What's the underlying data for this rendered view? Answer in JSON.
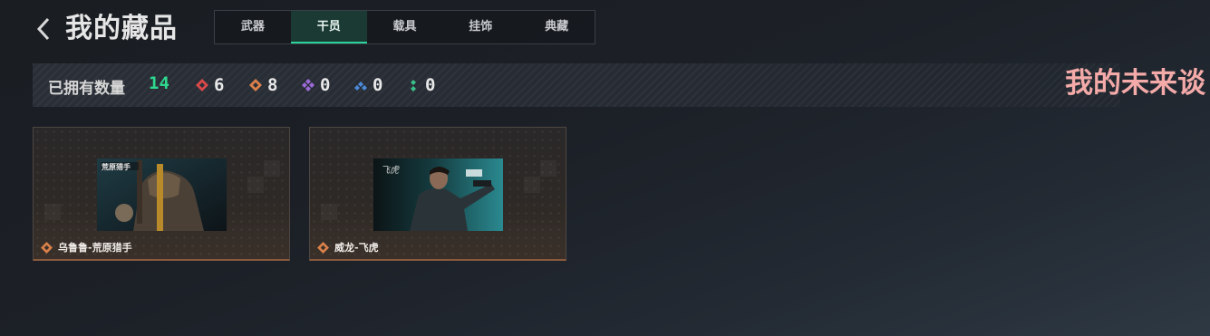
{
  "header": {
    "title": "我的藏品"
  },
  "tabs": [
    {
      "label": "武器",
      "active": false
    },
    {
      "label": "干员",
      "active": true
    },
    {
      "label": "载具",
      "active": false
    },
    {
      "label": "挂饰",
      "active": false
    },
    {
      "label": "典藏",
      "active": false
    }
  ],
  "stats": {
    "owned_label": "已拥有数量",
    "owned_count": "14",
    "rarities": [
      {
        "icon": "red-diamond-icon",
        "color": "#d9484a",
        "count": "6"
      },
      {
        "icon": "orange-diamond-icon",
        "color": "#d9804a",
        "count": "8"
      },
      {
        "icon": "purple-diamond-icon",
        "color": "#9a6ad8",
        "count": "0"
      },
      {
        "icon": "blue-diamond-icon",
        "color": "#4a8ad8",
        "count": "0"
      },
      {
        "icon": "green-diamond-icon",
        "color": "#3ac08a",
        "count": "0"
      }
    ]
  },
  "marquee": {
    "text": "我的未来谈"
  },
  "cards": [
    {
      "name": "乌鲁鲁-荒原猎手",
      "rarity_color": "#d9804a",
      "image_logo": "荒原猎手"
    },
    {
      "name": "威龙-飞虎",
      "rarity_color": "#d9804a",
      "image_logo": "飞虎"
    }
  ],
  "colors": {
    "accent": "#2bd39a",
    "count_green": "#2fd88f",
    "marquee_pink": "#f3aaa8"
  }
}
